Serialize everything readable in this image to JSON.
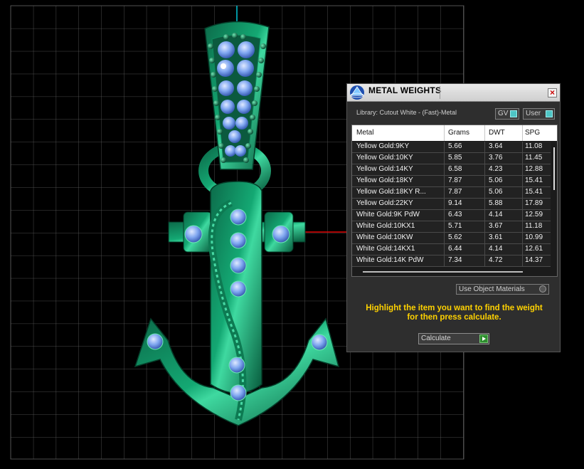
{
  "panel": {
    "title": "METAL WEIGHTS",
    "close_label": "×",
    "library_label": "Library: Cutout White - (Fast)-Metal",
    "gv_label": "GV",
    "user_label": "User",
    "use_object_materials_label": "Use Object Materials",
    "hint_line1": "Highlight the item you want to find the weight",
    "hint_line2": "for then press calculate.",
    "calculate_label": "Calculate"
  },
  "table": {
    "headers": [
      "Metal",
      "Grams",
      "DWT",
      "SPG"
    ],
    "rows": [
      [
        "Yellow Gold:9KY",
        "5.66",
        "3.64",
        "11.08"
      ],
      [
        "Yellow Gold:10KY",
        "5.85",
        "3.76",
        "11.45"
      ],
      [
        "Yellow Gold:14KY",
        "6.58",
        "4.23",
        "12.88"
      ],
      [
        "Yellow Gold:18KY",
        "7.87",
        "5.06",
        "15.41"
      ],
      [
        "Yellow Gold:18KY R...",
        "7.87",
        "5.06",
        "15.41"
      ],
      [
        "Yellow Gold:22KY",
        "9.14",
        "5.88",
        "17.89"
      ],
      [
        "White Gold:9K PdW",
        "6.43",
        "4.14",
        "12.59"
      ],
      [
        "White Gold:10KX1",
        "5.71",
        "3.67",
        "11.18"
      ],
      [
        "White Gold:10KW",
        "5.62",
        "3.61",
        "10.99"
      ],
      [
        "White Gold:14KX1",
        "6.44",
        "4.14",
        "12.61"
      ],
      [
        "White Gold:14K PdW",
        "7.34",
        "4.72",
        "14.37"
      ]
    ]
  },
  "colors": {
    "hint_text": "#ffd200",
    "model_green": "#0a8a5e",
    "gem_blue": "#7fa6f0",
    "grid_line": "#6a6a6a",
    "axis_red": "#e00000",
    "axis_cyan": "#00c8d8"
  }
}
